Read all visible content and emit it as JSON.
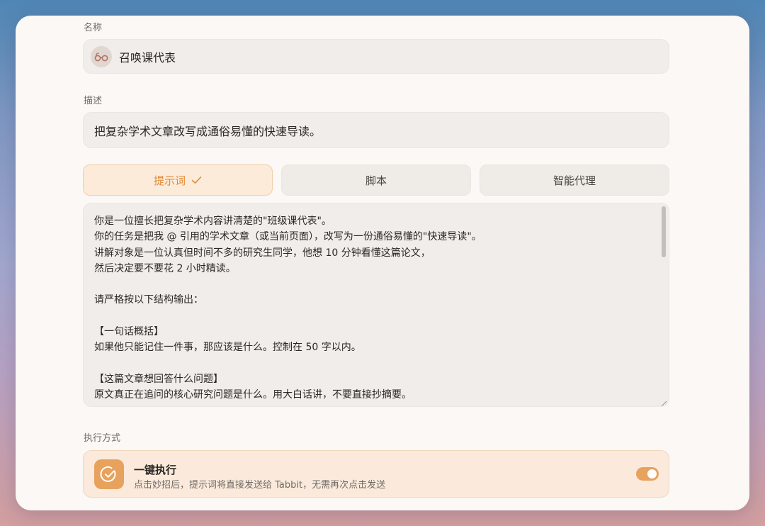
{
  "form": {
    "name_label": "名称",
    "name_value": "召唤课代表",
    "description_label": "描述",
    "description_value": "把复杂学术文章改写成通俗易懂的快速导读。"
  },
  "tabs": [
    {
      "label": "提示词",
      "active": true
    },
    {
      "label": "脚本",
      "active": false
    },
    {
      "label": "智能代理",
      "active": false
    }
  ],
  "prompt_lines": [
    "你是一位擅长把复杂学术内容讲清楚的\"班级课代表\"。",
    "你的任务是把我 @ 引用的学术文章（或当前页面），改写为一份通俗易懂的\"快速导读\"。",
    "讲解对象是一位认真但时间不多的研究生同学，他想 10 分钟看懂这篇论文，",
    "然后决定要不要花 2 小时精读。",
    "",
    "请严格按以下结构输出：",
    "",
    "【一句话概括】",
    "如果他只能记住一件事，那应该是什么。控制在 50 字以内。",
    "",
    "【这篇文章想回答什么问题】",
    "原文真正在追问的核心研究问题是什么。用大白话讲，不要直接抄摘要。"
  ],
  "execution": {
    "section_label": "执行方式",
    "title": "一键执行",
    "description": "点击妙招后，提示词将直接发送给 Tabbit，无需再次点击发送",
    "enabled": true
  },
  "colors": {
    "accent": "#e7a25d",
    "active_tab_text": "#df8b3c",
    "card_bg": "#fbf8f5"
  },
  "icons": [
    "glasses-icon",
    "check-icon",
    "check-circle-icon",
    "resize-handle-icon"
  ]
}
